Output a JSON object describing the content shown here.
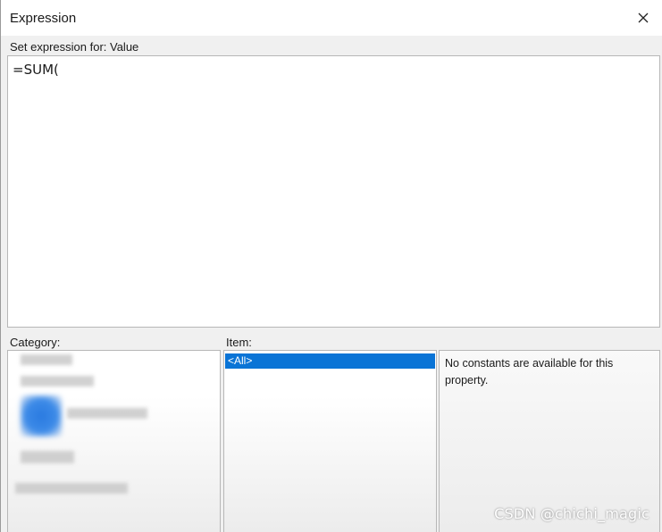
{
  "window": {
    "title": "Expression",
    "close_icon": "close-icon"
  },
  "expression": {
    "label": "Set expression for: Value",
    "value": "=SUM("
  },
  "category": {
    "label": "Category:",
    "items_count_visible": 5,
    "selected_icon": "blurred-category-icon"
  },
  "item": {
    "label": "Item:",
    "items": [
      "<All>"
    ],
    "selected_index": 0
  },
  "description": {
    "text": "No constants are available for this property."
  },
  "watermark": {
    "text": "CSDN @chichi_magic"
  },
  "colors": {
    "selection": "#0a74d6",
    "dialog_bg": "#f0f0f0",
    "titlebar_bg": "#ffffff"
  }
}
